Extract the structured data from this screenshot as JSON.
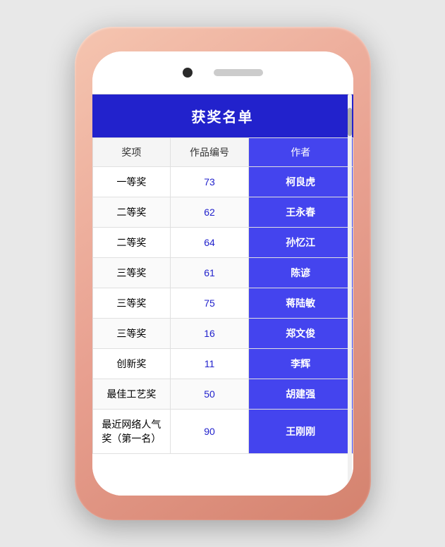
{
  "phone": {
    "title": "获奖名单"
  },
  "table": {
    "columns": [
      "奖项",
      "作品编号",
      "作者"
    ],
    "rows": [
      {
        "prize": "一等奖",
        "id": "73",
        "author": "柯良虎"
      },
      {
        "prize": "二等奖",
        "id": "62",
        "author": "王永春"
      },
      {
        "prize": "二等奖",
        "id": "64",
        "author": "孙忆江"
      },
      {
        "prize": "三等奖",
        "id": "61",
        "author": "陈谚"
      },
      {
        "prize": "三等奖",
        "id": "75",
        "author": "蒋陆敏"
      },
      {
        "prize": "三等奖",
        "id": "16",
        "author": "郑文俊"
      },
      {
        "prize": "创新奖",
        "id": "11",
        "author": "李辉"
      },
      {
        "prize": "最佳工艺奖",
        "id": "50",
        "author": "胡建强"
      },
      {
        "prize": "最近网络人气奖（第一名）",
        "id": "90",
        "author": "王刚刚"
      }
    ]
  }
}
